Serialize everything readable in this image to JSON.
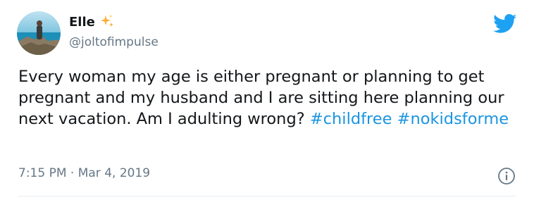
{
  "user": {
    "display_name": "Elle",
    "handle": "@joltofimpulse",
    "name_emoji": "sparkles-icon"
  },
  "tweet": {
    "text": "Every woman my age is either pregnant or planning to get pregnant and my husband and I are sitting here planning our next vacation. Am I adulting wrong?",
    "hashtags": [
      "#childfree",
      "#nokidsforme"
    ],
    "time": "7:15 PM",
    "separator": "·",
    "date": "Mar 4, 2019"
  },
  "icons": {
    "brand": "twitter-bird-icon",
    "info": "info-icon"
  },
  "colors": {
    "hashtag": "#1b95e0",
    "twitter_blue": "#1da1f2",
    "sparkle": "#ffac33",
    "secondary_text": "#657786"
  }
}
